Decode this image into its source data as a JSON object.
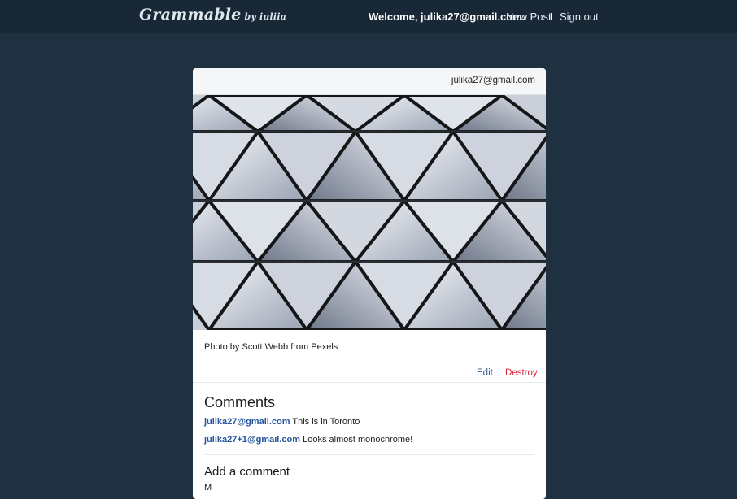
{
  "navbar": {
    "brand": "Grammable",
    "brand_by": "by iuliia",
    "welcome": "Welcome, julika27@gmail.com.",
    "new_post": "New Post",
    "separator": "I",
    "sign_out": "Sign out"
  },
  "post": {
    "user_email": "julika27@gmail.com",
    "photo_alt": "Architectural triangular glass ceiling",
    "caption": "Photo by Scott Webb from Pexels",
    "edit": "Edit",
    "destroy": "Destroy"
  },
  "comments": {
    "title": "Comments",
    "items": [
      {
        "author": "julika27@gmail.com",
        "text": "This is in Toronto"
      },
      {
        "author": "julika27+1@gmail.com",
        "text": "Looks almost monochrome!"
      }
    ],
    "add_title": "Add a comment",
    "field_label": "M"
  },
  "colors": {
    "page_bg": "#1f3040",
    "navbar_bg": "#182836",
    "link_blue": "#2b5d92",
    "destroy_red": "#d9233b"
  }
}
